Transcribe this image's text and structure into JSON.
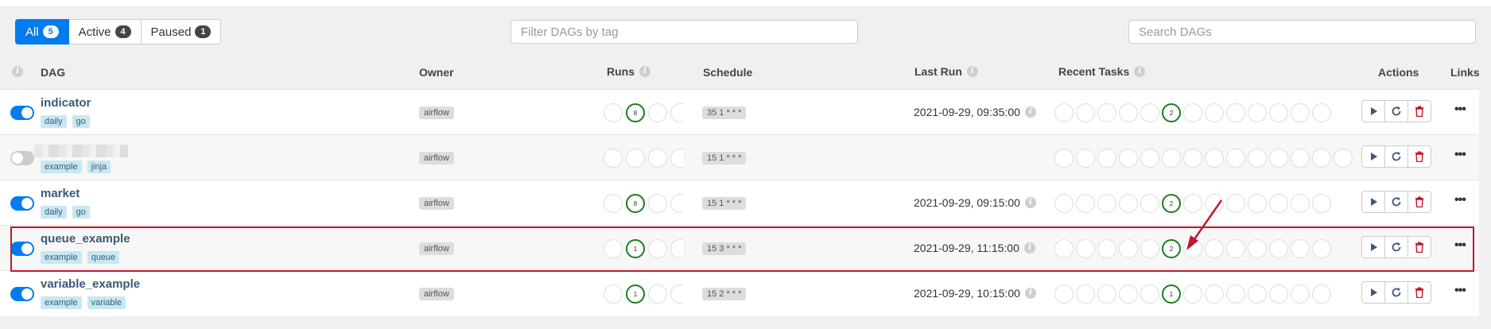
{
  "filters": {
    "all": {
      "label": "All",
      "count": "5"
    },
    "active": {
      "label": "Active",
      "count": "4"
    },
    "paused": {
      "label": "Paused",
      "count": "1"
    }
  },
  "tag_filter": {
    "placeholder": "Filter DAGs by tag"
  },
  "search": {
    "placeholder": "Search DAGs"
  },
  "headers": {
    "dag": "DAG",
    "owner": "Owner",
    "runs": "Runs",
    "schedule": "Schedule",
    "last_run": "Last Run",
    "recent_tasks": "Recent Tasks",
    "actions": "Actions",
    "links": "Links"
  },
  "rows": [
    {
      "name": "indicator",
      "tags": [
        "daily",
        "go"
      ],
      "owner": "airflow",
      "runs_success": "8",
      "schedule": "35 1 * * *",
      "last_run": "2021-09-29, 09:35:00",
      "tasks_success": "2",
      "active": true
    },
    {
      "name": "",
      "tags": [
        "example",
        "jinja"
      ],
      "owner": "airflow",
      "runs_success": "",
      "schedule": "15 1 * * *",
      "last_run": "",
      "tasks_success": "",
      "active": false
    },
    {
      "name": "market",
      "tags": [
        "daily",
        "go"
      ],
      "owner": "airflow",
      "runs_success": "8",
      "schedule": "15 1 * * *",
      "last_run": "2021-09-29, 09:15:00",
      "tasks_success": "2",
      "active": true
    },
    {
      "name": "queue_example",
      "tags": [
        "example",
        "queue"
      ],
      "owner": "airflow",
      "runs_success": "1",
      "schedule": "15 3 * * *",
      "last_run": "2021-09-29, 11:15:00",
      "tasks_success": "2",
      "active": true
    },
    {
      "name": "variable_example",
      "tags": [
        "example",
        "variable"
      ],
      "owner": "airflow",
      "runs_success": "1",
      "schedule": "15 2 * * *",
      "last_run": "2021-09-29, 10:15:00",
      "tasks_success": "1",
      "active": true
    }
  ],
  "links_label": "•••",
  "colors": {
    "primary": "#017cee",
    "success": "#1a7e1a",
    "danger": "#c3162c"
  }
}
